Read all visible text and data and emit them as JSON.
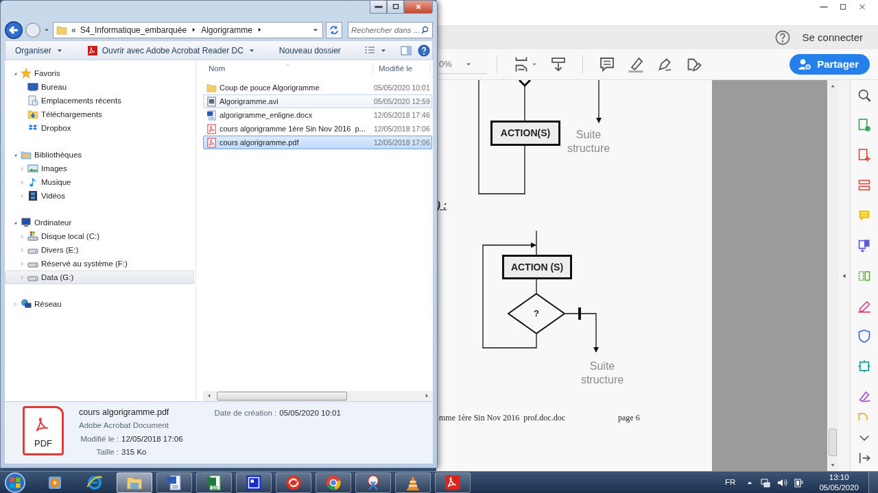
{
  "explorer": {
    "address": {
      "overflow": "«",
      "crumbs": [
        "S4_Informatique_embarquée",
        "Algorigramme"
      ]
    },
    "search": {
      "placeholder": "Rechercher dans ..."
    },
    "commands": [
      {
        "label": "Organiser",
        "kind": "menu"
      },
      {
        "label": "Ouvrir avec Adobe Acrobat Reader DC",
        "kind": "open-with"
      },
      {
        "label": "Nouveau dossier",
        "kind": "plain"
      }
    ],
    "nav": [
      {
        "label": "Favoris",
        "kind": "star",
        "expanded": true,
        "selected": false,
        "children": [
          {
            "label": "Bureau",
            "kind": "desktop",
            "selected": false
          },
          {
            "label": "Emplacements récents",
            "kind": "recent",
            "selected": false
          },
          {
            "label": "Téléchargements",
            "kind": "downloads",
            "selected": false
          },
          {
            "label": "Dropbox",
            "kind": "dropbox",
            "selected": false
          }
        ]
      },
      {
        "label": "Bibliothèques",
        "kind": "library",
        "expanded": true,
        "selected": false,
        "children": [
          {
            "label": "Images",
            "kind": "images",
            "expanded": false,
            "selected": false
          },
          {
            "label": "Musique",
            "kind": "music",
            "expanded": false,
            "selected": false
          },
          {
            "label": "Vidéos",
            "kind": "videos",
            "expanded": false,
            "selected": false
          }
        ]
      },
      {
        "label": "Ordinateur",
        "kind": "computer",
        "expanded": true,
        "selected": false,
        "children": [
          {
            "label": "Disque local (C:)",
            "kind": "disk-windows",
            "expanded": false,
            "selected": false
          },
          {
            "label": "Divers (E:)",
            "kind": "drive",
            "expanded": false,
            "selected": false
          },
          {
            "label": "Réservé au système (F:)",
            "kind": "drive",
            "expanded": false,
            "selected": false
          },
          {
            "label": "Data (G:)",
            "kind": "drive",
            "expanded": false,
            "selected": true
          }
        ]
      },
      {
        "label": "Réseau",
        "kind": "network",
        "expanded": false,
        "selected": false
      }
    ],
    "columns": [
      "Nom",
      "Modifié le"
    ],
    "files": [
      {
        "name": "Coup de pouce Algorigramme",
        "modified": "05/05/2020 10:01",
        "kind": "folder",
        "hovered": false,
        "selected": false
      },
      {
        "name": "Algorigramme.avi",
        "modified": "05/05/2020 12:59",
        "kind": "video",
        "hovered": true,
        "selected": false
      },
      {
        "name": "algorigramme_enligne.docx",
        "modified": "12/05/2018 17:46",
        "kind": "word",
        "hovered": false,
        "selected": false
      },
      {
        "name": "cours algorigramme 1ère Sin Nov 2016  p...",
        "modified": "12/05/2018 17:06",
        "kind": "pdf",
        "hovered": false,
        "selected": false
      },
      {
        "name": "cours algorigramme.pdf",
        "modified": "12/05/2018 17:06",
        "kind": "pdf",
        "hovered": false,
        "selected": true
      }
    ],
    "details": {
      "icon_label": "PDF",
      "name": "cours algorigramme.pdf",
      "type": "Adobe Acrobat Document",
      "fields": [
        {
          "label": "Modifié le :",
          "value": "12/05/2018 17:06"
        },
        {
          "label": "Taille :",
          "value": "315 Ko"
        }
      ],
      "created": {
        "label": "Date de création :",
        "value": "05/05/2020 10:01"
      }
    }
  },
  "acrobat": {
    "sign_in": "Se connecter",
    "zoom": "0%",
    "share": "Partager",
    "document": {
      "heading_fragment": ") :",
      "diagrams": [
        {
          "kind": "cut-top",
          "action": "ACTION(S)",
          "exit": "Suite structure"
        },
        {
          "kind": "repeat-until",
          "action": "ACTION (S)",
          "condition": "?",
          "exit": "Suite structure"
        }
      ],
      "footer": "mme 1ère Sin Nov 2016  prof.doc.doc",
      "page": "page 6"
    }
  },
  "taskbar": {
    "apps": [
      {
        "kind": "media",
        "running": false,
        "active": false
      },
      {
        "kind": "ie",
        "running": false,
        "active": false
      },
      {
        "kind": "explorer",
        "running": true,
        "active": true
      },
      {
        "kind": "word",
        "running": true,
        "active": false
      },
      {
        "kind": "excel",
        "running": true,
        "active": false
      },
      {
        "kind": "remote",
        "running": true,
        "active": false
      },
      {
        "kind": "swirl",
        "running": true,
        "active": false
      },
      {
        "kind": "chrome",
        "running": true,
        "active": false
      },
      {
        "kind": "snip",
        "running": true,
        "active": false
      },
      {
        "kind": "vlc",
        "running": true,
        "active": false
      },
      {
        "kind": "acrobat",
        "running": true,
        "active": false
      }
    ],
    "tray": {
      "language": "FR",
      "time": "13:10",
      "date": "05/05/2020"
    }
  }
}
